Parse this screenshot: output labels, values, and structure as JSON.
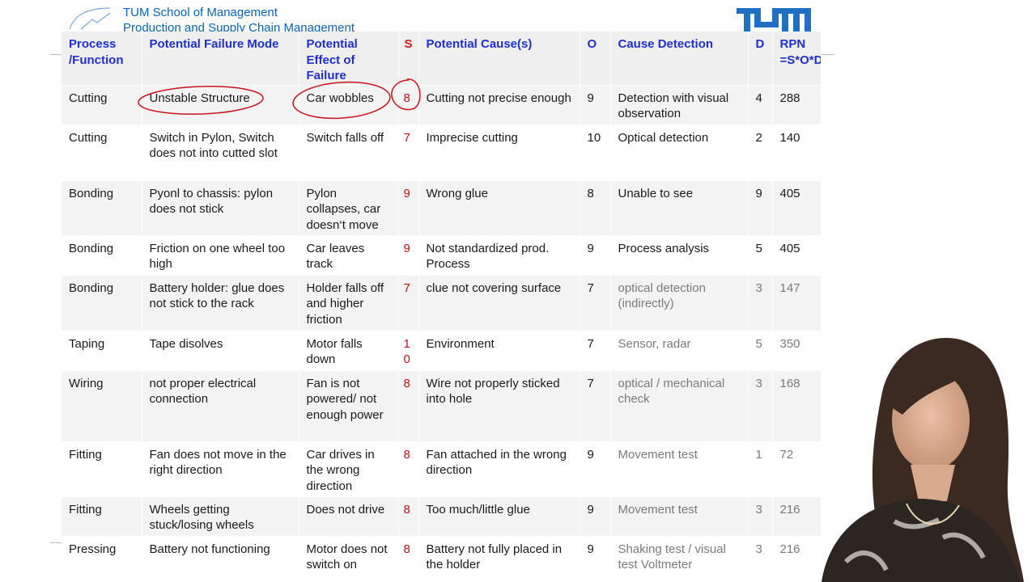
{
  "header": {
    "school_name": "TUM School of Management",
    "school_sub": "Production and Supply Chain Management"
  },
  "colors": {
    "header_text": "#1f2fd0",
    "severity_red": "#c0101a",
    "logo_blue": "#0b62b8",
    "annotation_red": "#c8141e"
  },
  "table": {
    "headers": [
      "Process /Function",
      "Potential Failure Mode",
      "Potential Effect of Failure",
      "S",
      "Potential Cause(s)",
      "O",
      "Cause Detection",
      "D",
      "RPN =S*O*D"
    ],
    "rows": [
      [
        "Cutting",
        "Unstable Structure",
        "Car wobbles",
        "8",
        "Cutting not precise enough",
        "9",
        "Detection with visual observation",
        "4",
        "288"
      ],
      [
        "Cutting",
        "Switch in Pylon, Switch does not into cutted slot",
        "Switch falls off",
        "7",
        "Imprecise cutting",
        "10",
        "Optical detection",
        "2",
        "140"
      ],
      [
        "Bonding",
        "Pyonl to chassis: pylon does not stick",
        "Pylon collapses, car doesn‘t move",
        "9",
        "Wrong glue",
        "8",
        "Unable to see",
        "9",
        "405"
      ],
      [
        "Bonding",
        "Friction on one wheel too high",
        "Car leaves track",
        "9",
        "Not standardized prod. Process",
        "9",
        "Process analysis",
        "5",
        "405"
      ],
      [
        "Bonding",
        "Battery holder: glue does not stick to the rack",
        "Holder falls off and higher friction",
        "7",
        "clue not covering surface",
        "7",
        "optical detection (indirectly)",
        "3",
        "147"
      ],
      [
        "Taping",
        "Tape disolves",
        "Motor falls down",
        "1\n0",
        "Environment",
        "7",
        "Sensor, radar",
        "5",
        "350"
      ],
      [
        "Wiring",
        "not proper electrical connection",
        "Fan is not powered/ not enough power",
        "8",
        "Wire not properly sticked into hole",
        "7",
        "optical / mechanical check",
        "3",
        "168"
      ],
      [
        "Fitting",
        "Fan does not move in the right direction",
        "Car drives in the wrong direction",
        "8",
        "Fan attached in the wrong direction",
        "9",
        "Movement test",
        "1",
        "72"
      ],
      [
        "Fitting",
        "Wheels getting stuck/losing wheels",
        "Does not drive",
        "8",
        "Too much/little glue",
        "9",
        "Movement test",
        "3",
        "216"
      ],
      [
        "Pressing",
        "Battery not functioning",
        "Motor does not switch on",
        "8",
        "Battery not fully placed in the holder",
        "9",
        "Shaking test / visual test Voltmeter",
        "3",
        "216"
      ]
    ]
  }
}
